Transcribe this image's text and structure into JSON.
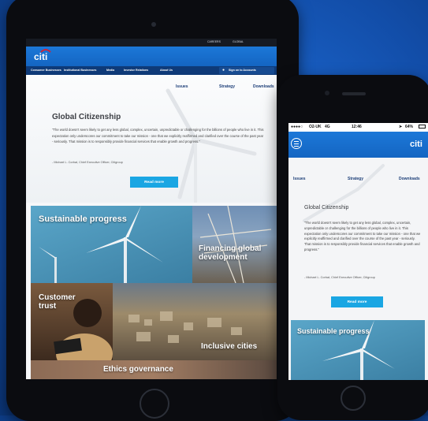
{
  "tablet": {
    "utility_links": [
      "CAREERS",
      "GLOBAL"
    ],
    "logo": "citi",
    "nav_items": [
      "Consumer Businesses",
      "Institutional Businesses",
      "Media",
      "Investor Relations",
      "About Us"
    ],
    "sign_on": "Sign on to Accounts",
    "subnav": [
      "Issues",
      "Strategy",
      "Downloads"
    ],
    "title": "Global Citizenship",
    "quote": "\"The world doesn't seem likely to get any less global, complex, uncertain, unpredictable or challenging for the billions of people who live in it. This expectation only underscores our commitment to take our mission - one that we explicitly reaffirmed and clarified over the course of the past year - seriously. That mission is to responsibly provide financial services that enable growth and progress.\"",
    "attribution": "- Michael L. Corbat, Chief Executive Officer, Citigroup",
    "read_more": "Read more",
    "tiles": [
      "Sustainable progress",
      "Financing global development",
      "Customer trust",
      "Inclusive cities",
      "Ethics governance"
    ]
  },
  "phone": {
    "carrier": "O2-UK",
    "network": "4G",
    "time": "12:46",
    "battery": "64%",
    "logo": "citi",
    "subnav": [
      "Issues",
      "Strategy",
      "Downloads"
    ],
    "title": "Global Citizenship",
    "quote": "\"The world doesn't seem likely to get any less global, complex, uncertain, unpredictable or challenging for the billions of people who live in it. This expectation only underscores our commitment to take our mission - one that we explicitly reaffirmed and clarified over the course of the past year - seriously. That mission is to responsibly provide financial services that enable growth and progress.\"",
    "attribution": "- Michael L. Corbat, Chief Executive Officer, Citigroup",
    "read_more": "Read more",
    "tile": "Sustainable progress"
  },
  "colors": {
    "background": "#1560c8",
    "citi_blue": "#1c78d8",
    "citi_navy": "#0e3a78",
    "button": "#1aa6e3"
  }
}
